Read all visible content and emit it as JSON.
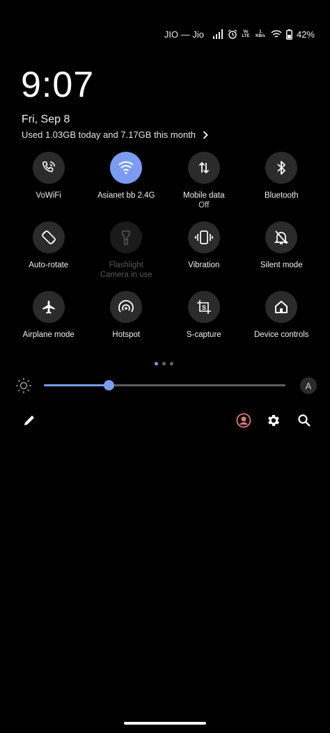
{
  "status_bar": {
    "carrier": "JIO — Jio",
    "volte": "Vo LTE",
    "speed": "1 KB/s",
    "battery": "42%"
  },
  "clock": "9:07",
  "date": "Fri, Sep 8",
  "data_usage": "Used 1.03GB today and 7.17GB this month",
  "tiles": [
    {
      "label": "VoWiFi",
      "sub": "",
      "icon": "wifi-call-icon"
    },
    {
      "label": "Asianet bb 2.4G",
      "sub": "",
      "icon": "wifi-icon",
      "active": true
    },
    {
      "label": "Mobile data",
      "sub": "Off",
      "icon": "mobile-data-icon"
    },
    {
      "label": "Bluetooth",
      "sub": "",
      "icon": "bluetooth-icon"
    },
    {
      "label": "Auto-rotate",
      "sub": "",
      "icon": "auto-rotate-icon"
    },
    {
      "label": "Flashlight",
      "sub": "Camera in use",
      "icon": "flashlight-icon",
      "disabled": true
    },
    {
      "label": "Vibration",
      "sub": "",
      "icon": "vibration-icon"
    },
    {
      "label": "Silent mode",
      "sub": "",
      "icon": "silent-mode-icon"
    },
    {
      "label": "Airplane mode",
      "sub": "",
      "icon": "airplane-icon"
    },
    {
      "label": "Hotspot",
      "sub": "",
      "icon": "hotspot-icon"
    },
    {
      "label": "S-capture",
      "sub": "",
      "icon": "s-capture-icon"
    },
    {
      "label": "Device controls",
      "sub": "",
      "icon": "home-icon"
    }
  ],
  "page_indicator": {
    "pages": 3,
    "current": 0
  },
  "brightness": {
    "level": 0.27,
    "auto_label": "A"
  },
  "colors": {
    "accent": "#7b9cf0",
    "tile_bg": "#2b2b2b",
    "avatar": "#e07a7a"
  }
}
